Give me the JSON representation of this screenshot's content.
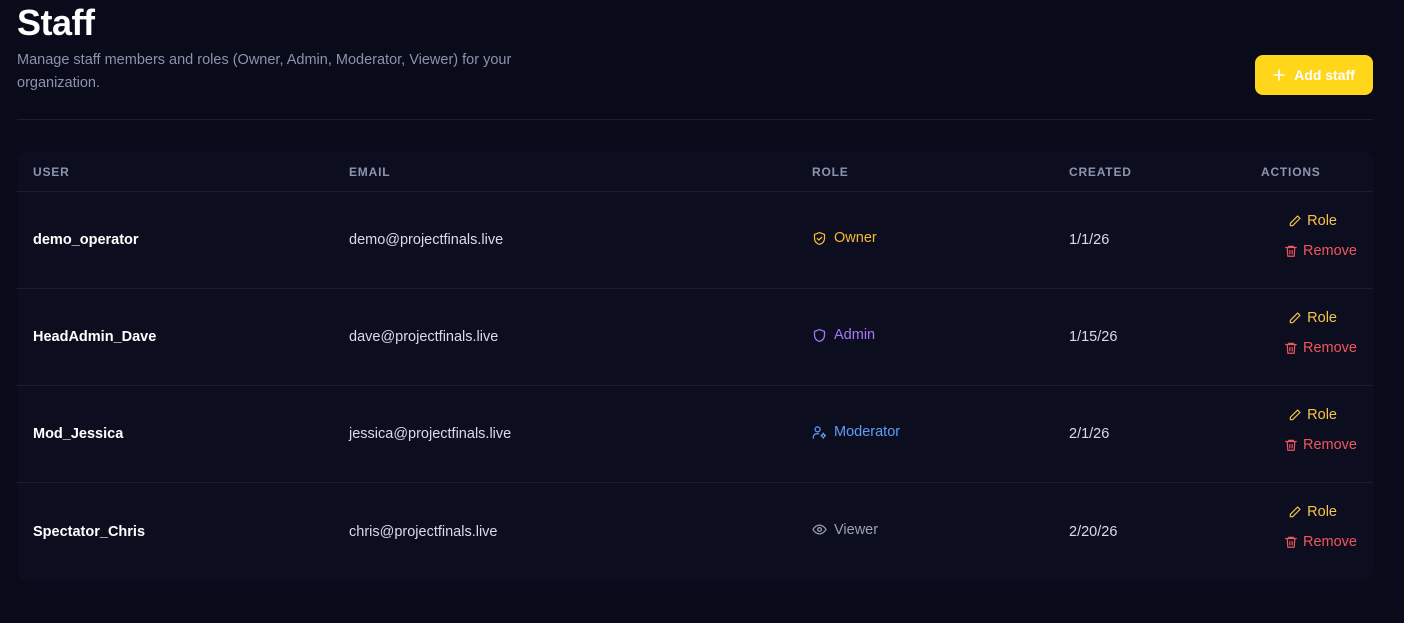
{
  "header": {
    "title": "Staff",
    "subtitle": "Manage staff members and roles (Owner, Admin, Moderator, Viewer) for your organization.",
    "add_button_label": "Add staff",
    "add_button_icon": "plus-icon"
  },
  "table": {
    "columns": {
      "user": "USER",
      "email": "EMAIL",
      "role": "ROLE",
      "created": "CREATED",
      "actions": "ACTIONS"
    },
    "action_labels": {
      "role": "Role",
      "remove": "Remove"
    },
    "rows": [
      {
        "user": "demo_operator",
        "email": "demo@projectfinals.live",
        "role": "Owner",
        "role_icon": "shield-check-icon",
        "role_color": "#f7b731",
        "created": "1/1/26"
      },
      {
        "user": "HeadAdmin_Dave",
        "email": "dave@projectfinals.live",
        "role": "Admin",
        "role_icon": "shield-icon",
        "role_color": "#a877f7",
        "created": "1/15/26"
      },
      {
        "user": "Mod_Jessica",
        "email": "jessica@projectfinals.live",
        "role": "Moderator",
        "role_icon": "user-cog-icon",
        "role_color": "#5d9ef5",
        "created": "2/1/26"
      },
      {
        "user": "Spectator_Chris",
        "email": "chris@projectfinals.live",
        "role": "Viewer",
        "role_icon": "eye-icon",
        "role_color": "#9aa1b6",
        "created": "2/20/26"
      }
    ]
  },
  "colors": {
    "background": "#090a1a",
    "accent": "#ffd61a",
    "role_action": "#f6c34a",
    "remove_action": "#f0565e"
  }
}
